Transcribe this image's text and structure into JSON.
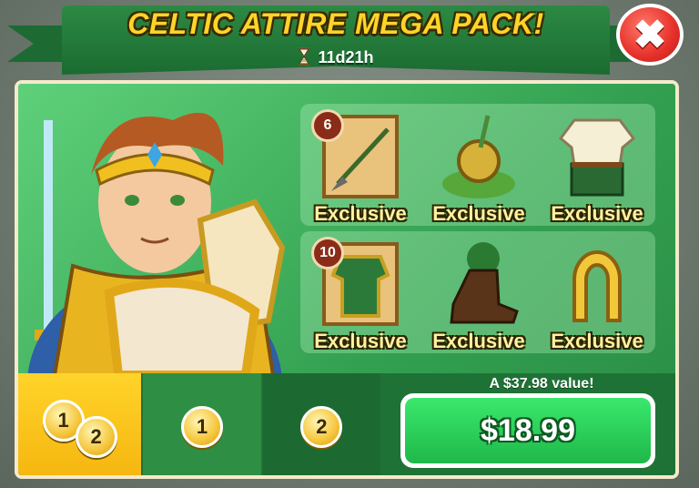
{
  "banner": {
    "title": "CELTIC ATTIRE MEGA PACK!",
    "timer": "11d21h"
  },
  "close": {
    "label": "✖"
  },
  "items": [
    {
      "badge": "6",
      "label": "Exclusive",
      "icon": "spear-scroll-icon"
    },
    {
      "badge": "",
      "label": "Exclusive",
      "icon": "celtic-shield-sword-icon"
    },
    {
      "badge": "",
      "label": "Exclusive",
      "icon": "celtic-tunic-icon"
    },
    {
      "badge": "10",
      "label": "Exclusive",
      "icon": "celtic-armor-scroll-icon"
    },
    {
      "badge": "",
      "label": "Exclusive",
      "icon": "clover-boot-icon"
    },
    {
      "badge": "",
      "label": "Exclusive",
      "icon": "golden-horseshoe-icon"
    }
  ],
  "tabs": [
    {
      "coins": [
        "1",
        "2"
      ],
      "active": true
    },
    {
      "coins": [
        "1"
      ],
      "active": false
    },
    {
      "coins": [
        "2"
      ],
      "active": false
    }
  ],
  "offer": {
    "value_text": "A $37.98 value!",
    "price": "$18.99"
  },
  "colors": {
    "banner": "#2c8a43",
    "title": "#ffd42a",
    "buy": "#1fb84a",
    "close": "#e6302a",
    "active_tab": "#ffd42a"
  }
}
